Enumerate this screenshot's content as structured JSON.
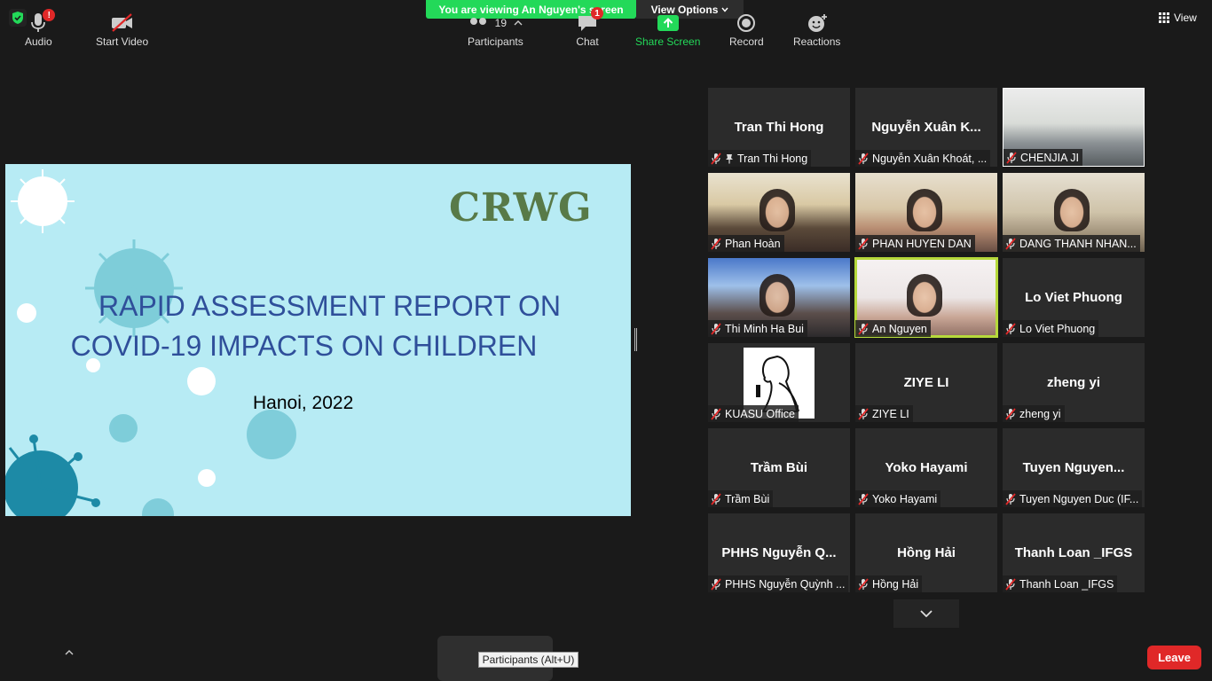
{
  "topbar": {
    "viewing_text": "You are viewing An Nguyen's screen",
    "view_options_label": "View Options",
    "view_label": "View"
  },
  "slide": {
    "logo_text": "CRWG",
    "title_line1": "RAPID ASSESSMENT REPORT ON",
    "title_line2": "COVID-19 IMPACTS ON CHILDREN",
    "subtitle": "Hanoi, 2022",
    "background_color": "#b7ebf4",
    "title_color": "#2f4f9a",
    "logo_color": "#587a48"
  },
  "participants_tiles": [
    {
      "center_name": "Tran Thi Hong",
      "label": "Tran Thi Hong",
      "pinned": true,
      "video": false
    },
    {
      "center_name": "Nguyễn Xuân K...",
      "label": "Nguyễn Xuân Khoát, ...",
      "video": false
    },
    {
      "center_name": "",
      "label": "CHENJIA JI",
      "video": true
    },
    {
      "center_name": "",
      "label": "Phan Hoàn",
      "video": true
    },
    {
      "center_name": "",
      "label": "PHAN HUYEN DAN",
      "video": true
    },
    {
      "center_name": "",
      "label": "DANG THANH NHAN...",
      "video": true
    },
    {
      "center_name": "",
      "label": "Thi Minh Ha Bui",
      "video": true
    },
    {
      "center_name": "",
      "label": "An Nguyen",
      "video": true,
      "active_speaker": true
    },
    {
      "center_name": "Lo Viet Phuong",
      "label": "Lo Viet Phuong",
      "video": false
    },
    {
      "center_name": "",
      "label": "KUASU Office",
      "video": false,
      "avatar": true
    },
    {
      "center_name": "ZIYE LI",
      "label": "ZIYE LI",
      "video": false
    },
    {
      "center_name": "zheng yi",
      "label": "zheng yi",
      "video": false
    },
    {
      "center_name": "Trầm Bùi",
      "label": "Trầm Bùi",
      "video": false
    },
    {
      "center_name": "Yoko Hayami",
      "label": "Yoko Hayami",
      "video": false
    },
    {
      "center_name": "Tuyen  Nguyen...",
      "label": "Tuyen Nguyen Duc (IF...",
      "video": false
    },
    {
      "center_name": "PHHS  Nguyễn  Q...",
      "label": "PHHS Nguyễn Quỳnh ...",
      "video": false
    },
    {
      "center_name": "Hồng Hải",
      "label": "Hồng Hải",
      "video": false
    },
    {
      "center_name": "Thanh Loan _IFGS",
      "label": "Thanh Loan _IFGS",
      "video": false
    }
  ],
  "toolbar": {
    "audio_label": "Audio",
    "audio_badge": "!",
    "start_video_label": "Start Video",
    "participants_label": "Participants",
    "participants_count": "19",
    "participants_tooltip": "Participants (Alt+U)",
    "chat_label": "Chat",
    "chat_badge": "1",
    "share_screen_label": "Share Screen",
    "record_label": "Record",
    "reactions_label": "Reactions",
    "leave_label": "Leave"
  },
  "colors": {
    "accent_green": "#23d959",
    "leave_red": "#e02828",
    "active_speaker": "#b6d93b",
    "background": "#1a1a1a"
  }
}
